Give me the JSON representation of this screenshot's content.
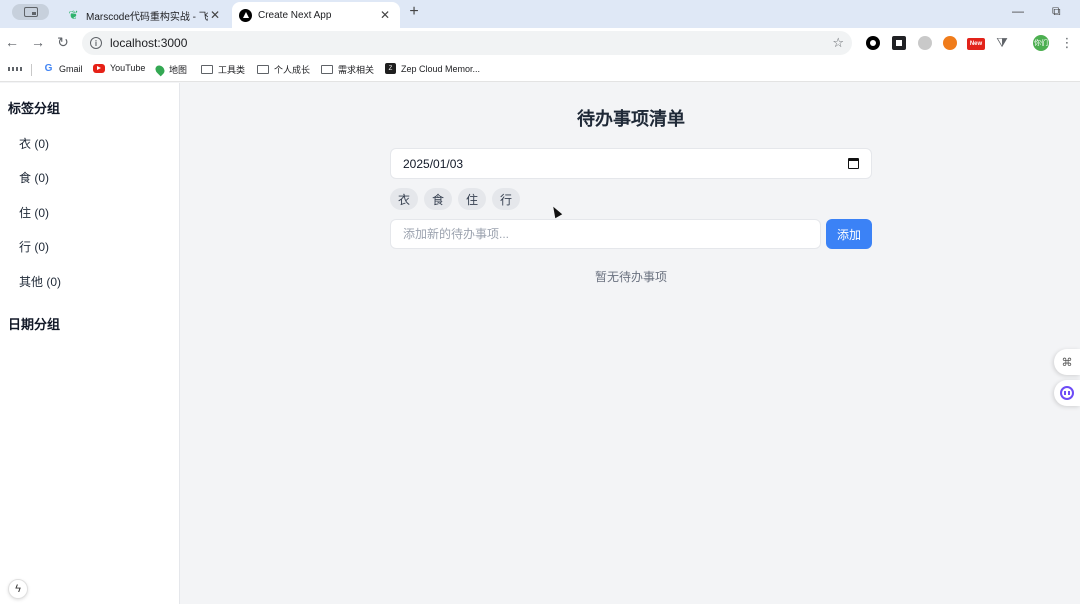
{
  "browser": {
    "tabs": [
      {
        "title": "Marscode代码重构实战 - 飞书",
        "favicon": "leaf-icon"
      },
      {
        "title": "Create Next App",
        "favicon": "nextjs-icon"
      }
    ],
    "url": "localhost:3000",
    "bookmarks": [
      {
        "label": "Gmail",
        "icon": "google-icon"
      },
      {
        "label": "YouTube",
        "icon": "youtube-icon"
      },
      {
        "label": "地图",
        "icon": "maps-icon"
      },
      {
        "label": "工具类",
        "icon": "folder-icon"
      },
      {
        "label": "个人成长",
        "icon": "folder-icon"
      },
      {
        "label": "需求相关",
        "icon": "folder-icon"
      },
      {
        "label": "Zep Cloud Memor...",
        "icon": "zep-icon"
      }
    ],
    "extension_badge": "New",
    "profile_initials": "你们"
  },
  "sidebar": {
    "tag_group_heading": "标签分组",
    "tag_items": [
      "衣 (0)",
      "食 (0)",
      "住 (0)",
      "行 (0)",
      "其他 (0)"
    ],
    "date_group_heading": "日期分组"
  },
  "main": {
    "title": "待办事项清单",
    "date_value": "2025/01/03",
    "tags": [
      "衣",
      "食",
      "住",
      "行"
    ],
    "input_placeholder": "添加新的待办事项...",
    "add_button": "添加",
    "empty_message": "暂无待办事项"
  },
  "colors": {
    "accent": "#3b82f6",
    "page_background": "#f3f4f6",
    "sidebar_background": "#ffffff",
    "tag_background": "#e5e7eb"
  }
}
